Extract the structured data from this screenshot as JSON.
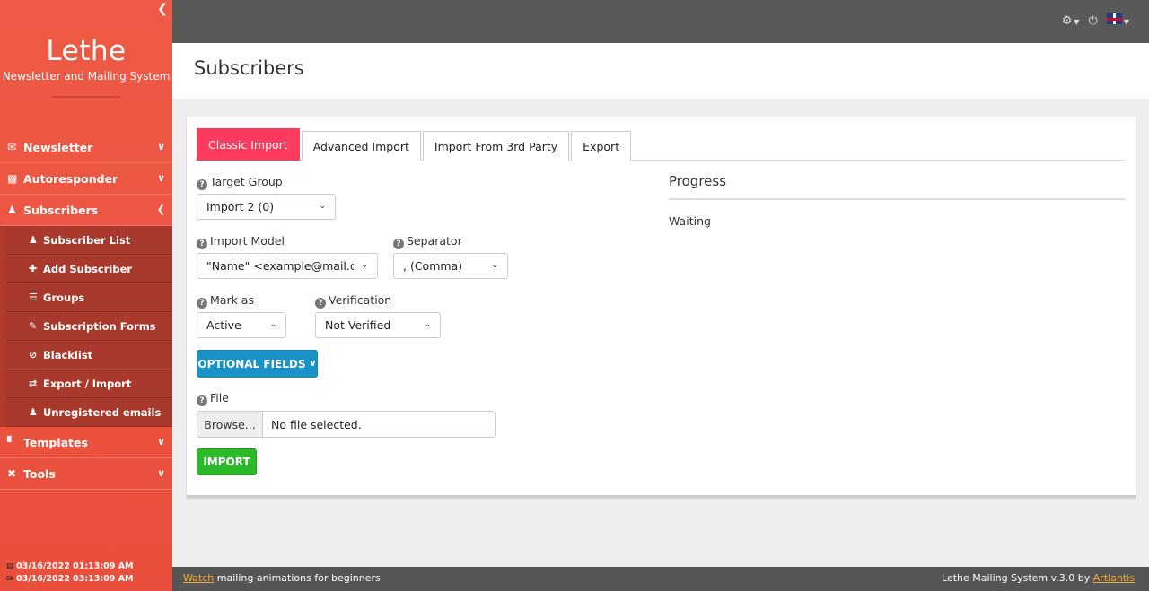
{
  "sidebar": {
    "brand_title": "Lethe",
    "brand_subtitle": "Newsletter and Mailing System",
    "items": [
      {
        "icon": "envelope-icon",
        "label": "Newsletter"
      },
      {
        "icon": "autoresponder-icon",
        "label": "Autoresponder"
      },
      {
        "icon": "users-icon",
        "label": "Subscribers"
      },
      {
        "icon": "paint-roller-icon",
        "label": "Templates"
      },
      {
        "icon": "tools-icon",
        "label": "Tools"
      }
    ],
    "subscriber_items": [
      {
        "icon": "users-icon",
        "label": "Subscriber List"
      },
      {
        "icon": "plus-icon",
        "label": "Add Subscriber"
      },
      {
        "icon": "list-icon",
        "label": "Groups"
      },
      {
        "icon": "edit-icon",
        "label": "Subscription Forms"
      },
      {
        "icon": "ban-icon",
        "label": "Blacklist"
      },
      {
        "icon": "exchange-icon",
        "label": "Export / Import"
      },
      {
        "icon": "user-slash-icon",
        "label": "Unregistered emails"
      }
    ],
    "footer": {
      "line1": "03/16/2022 01:13:09 AM",
      "line2": "03/16/2022 03:13:09 AM"
    }
  },
  "page": {
    "title": "Subscribers"
  },
  "tabs": [
    "Classic Import",
    "Advanced Import",
    "Import From 3rd Party",
    "Export"
  ],
  "form": {
    "target_group_label": "Target Group",
    "target_group_value": "Import 2 (0)",
    "import_model_label": "Import Model",
    "import_model_value": "\"Name\" <example@mail.com>",
    "separator_label": "Separator",
    "separator_value": ", (Comma)",
    "mark_as_label": "Mark as",
    "mark_as_value": "Active",
    "verification_label": "Verification",
    "verification_value": "Not Verified",
    "optional_fields_label": "OPTIONAL FIELDS",
    "file_label": "File",
    "browse_label": "Browse...",
    "file_name": "No file selected.",
    "import_label": "IMPORT"
  },
  "progress": {
    "title": "Progress",
    "status": "Waiting"
  },
  "footer": {
    "watch_link": "Watch",
    "watch_text": " mailing animations for beginners",
    "credit": "Lethe Mailing System v.3.0 by ",
    "credit_link": "Artlantis"
  },
  "colors": {
    "sidebar": "#ee5a45",
    "active_tab": "#ff3a5f",
    "optional_button": "#1b92c7",
    "import_button": "#2aba2a"
  }
}
